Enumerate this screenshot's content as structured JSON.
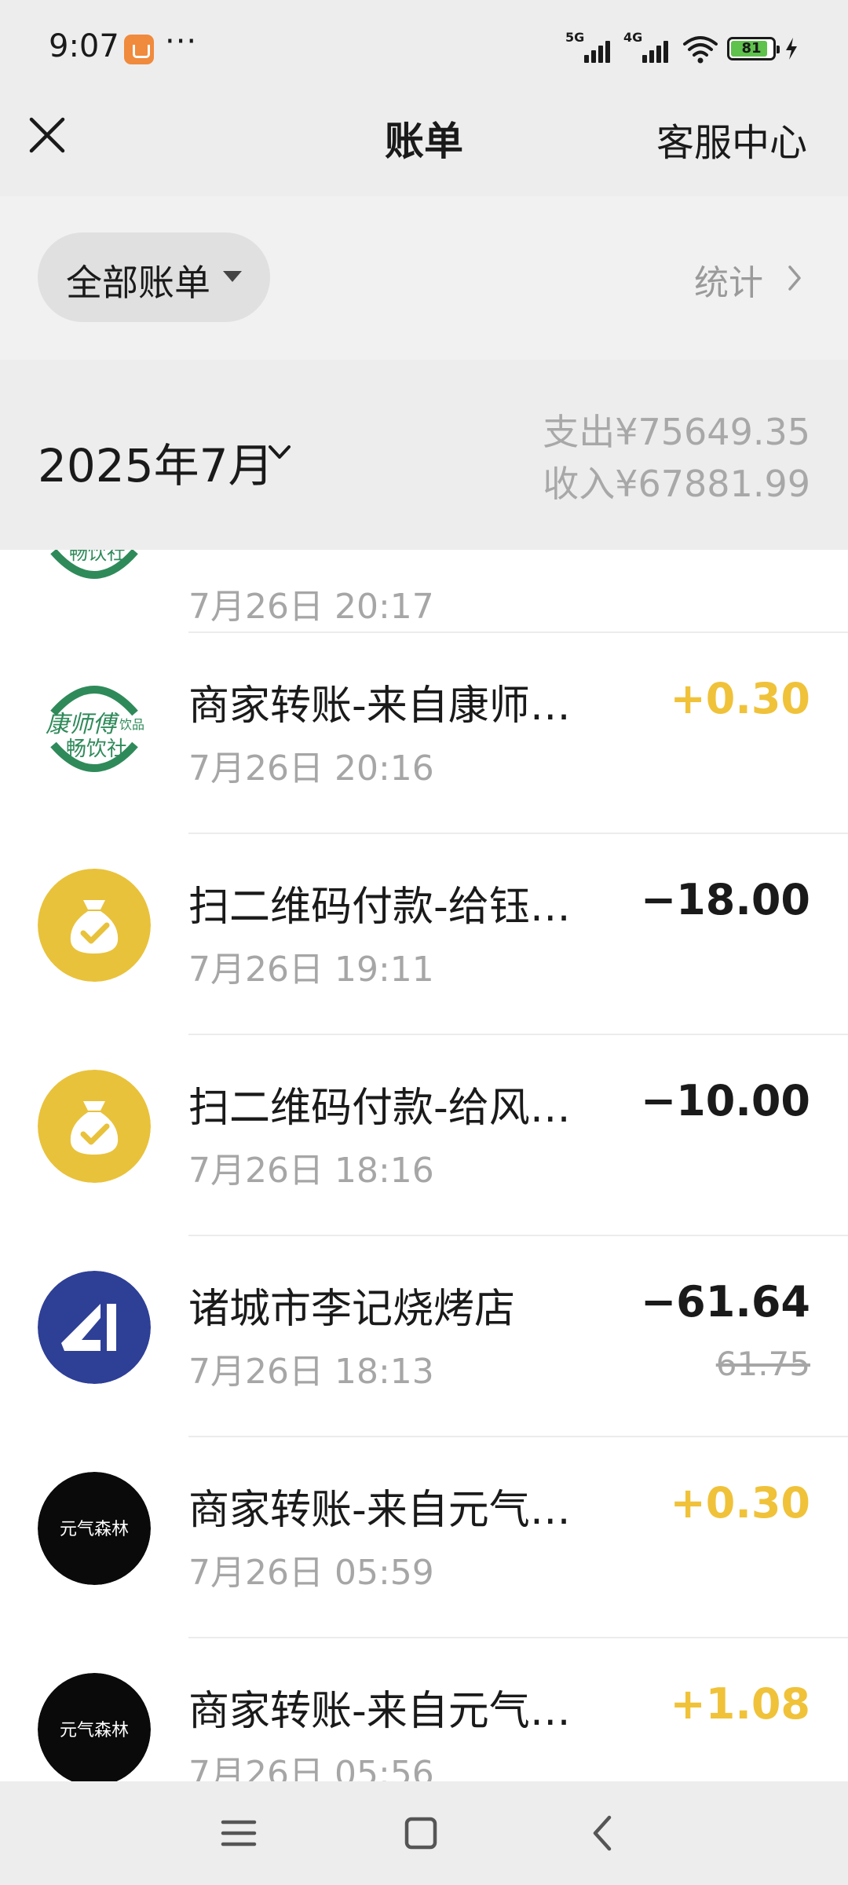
{
  "status_bar": {
    "time": "9:07",
    "more": "···",
    "signal_1_label": "5G",
    "signal_2_label": "4G",
    "battery_level": "81"
  },
  "header": {
    "title": "账单",
    "customer_service": "客服中心"
  },
  "filter": {
    "label": "全部账单",
    "stats_label": "统计"
  },
  "summary": {
    "month": "2025年7月",
    "expense": "支出¥75649.35",
    "income": "收入¥67881.99"
  },
  "transactions": [
    {
      "title": "",
      "time": "7月26日 20:17",
      "amount": "",
      "avatar": "kangshifu-logo"
    },
    {
      "title": "商家转账-来自康师…",
      "time": "7月26日 20:16",
      "amount": "+0.30",
      "type": "income",
      "avatar": "kangshifu-logo"
    },
    {
      "title": "扫二维码付款-给钰…",
      "time": "7月26日 19:11",
      "amount": "−18.00",
      "type": "expense",
      "avatar": "money-bag-icon"
    },
    {
      "title": "扫二维码付款-给风…",
      "time": "7月26日 18:16",
      "amount": "−10.00",
      "type": "expense",
      "avatar": "money-bag-icon"
    },
    {
      "title": "诸城市李记烧烤店",
      "time": "7月26日 18:13",
      "amount": "−61.64",
      "original_amount": "61.75",
      "type": "expense",
      "avatar": "merchant-logo"
    },
    {
      "title": "商家转账-来自元气…",
      "time": "7月26日 05:59",
      "amount": "+0.30",
      "type": "income",
      "avatar": "genki-forest-logo"
    },
    {
      "title": "商家转账-来自元气…",
      "time": "7月26日 05:56",
      "amount": "+1.08",
      "type": "income",
      "avatar": "genki-forest-logo"
    }
  ],
  "logos": {
    "kangshifu_line1": "康师傅",
    "kangshifu_small": "饮品",
    "kangshifu_line2": "畅饮社",
    "genki": "元气森林"
  },
  "colors": {
    "income": "#f0c23a",
    "expense": "#1a1a1a",
    "money_bag_bg": "#e9c23b",
    "merchant_bg": "#2e3f96",
    "kangshifu_green": "#2f8a5a"
  }
}
